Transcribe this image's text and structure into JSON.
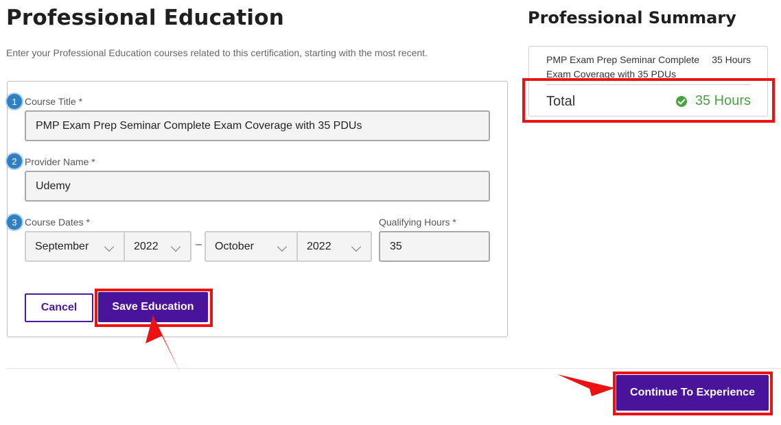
{
  "education": {
    "title": "Professional Education",
    "description": "Enter your Professional Education courses related to this certification, starting with the most recent.",
    "course_title": {
      "step": "1",
      "label": "Course Title *",
      "value": "PMP Exam Prep Seminar Complete Exam Coverage with 35 PDUs"
    },
    "provider_name": {
      "step": "2",
      "label": "Provider Name *",
      "value": "Udemy"
    },
    "course_dates": {
      "step": "3",
      "label": "Course Dates *",
      "start_month": "September",
      "start_year": "2022",
      "separator": "–",
      "end_month": "October",
      "end_year": "2022"
    },
    "qualifying_hours": {
      "label": "Qualifying Hours *",
      "value": "35"
    },
    "cancel_label": "Cancel",
    "save_label": "Save Education"
  },
  "summary": {
    "title": "Professional Summary",
    "course": "PMP Exam Prep Seminar Complete Exam Coverage with 35 PDUs",
    "course_hours": "35 Hours",
    "total_label": "Total",
    "total_value": "35 Hours",
    "total_icon": "check-circle-icon"
  },
  "footer": {
    "continue_label": "Continue To Experience"
  },
  "colors": {
    "accent": "#4a149a",
    "highlight": "#ee1111",
    "step_badge": "#2f7fc1",
    "success": "#4aa143"
  }
}
